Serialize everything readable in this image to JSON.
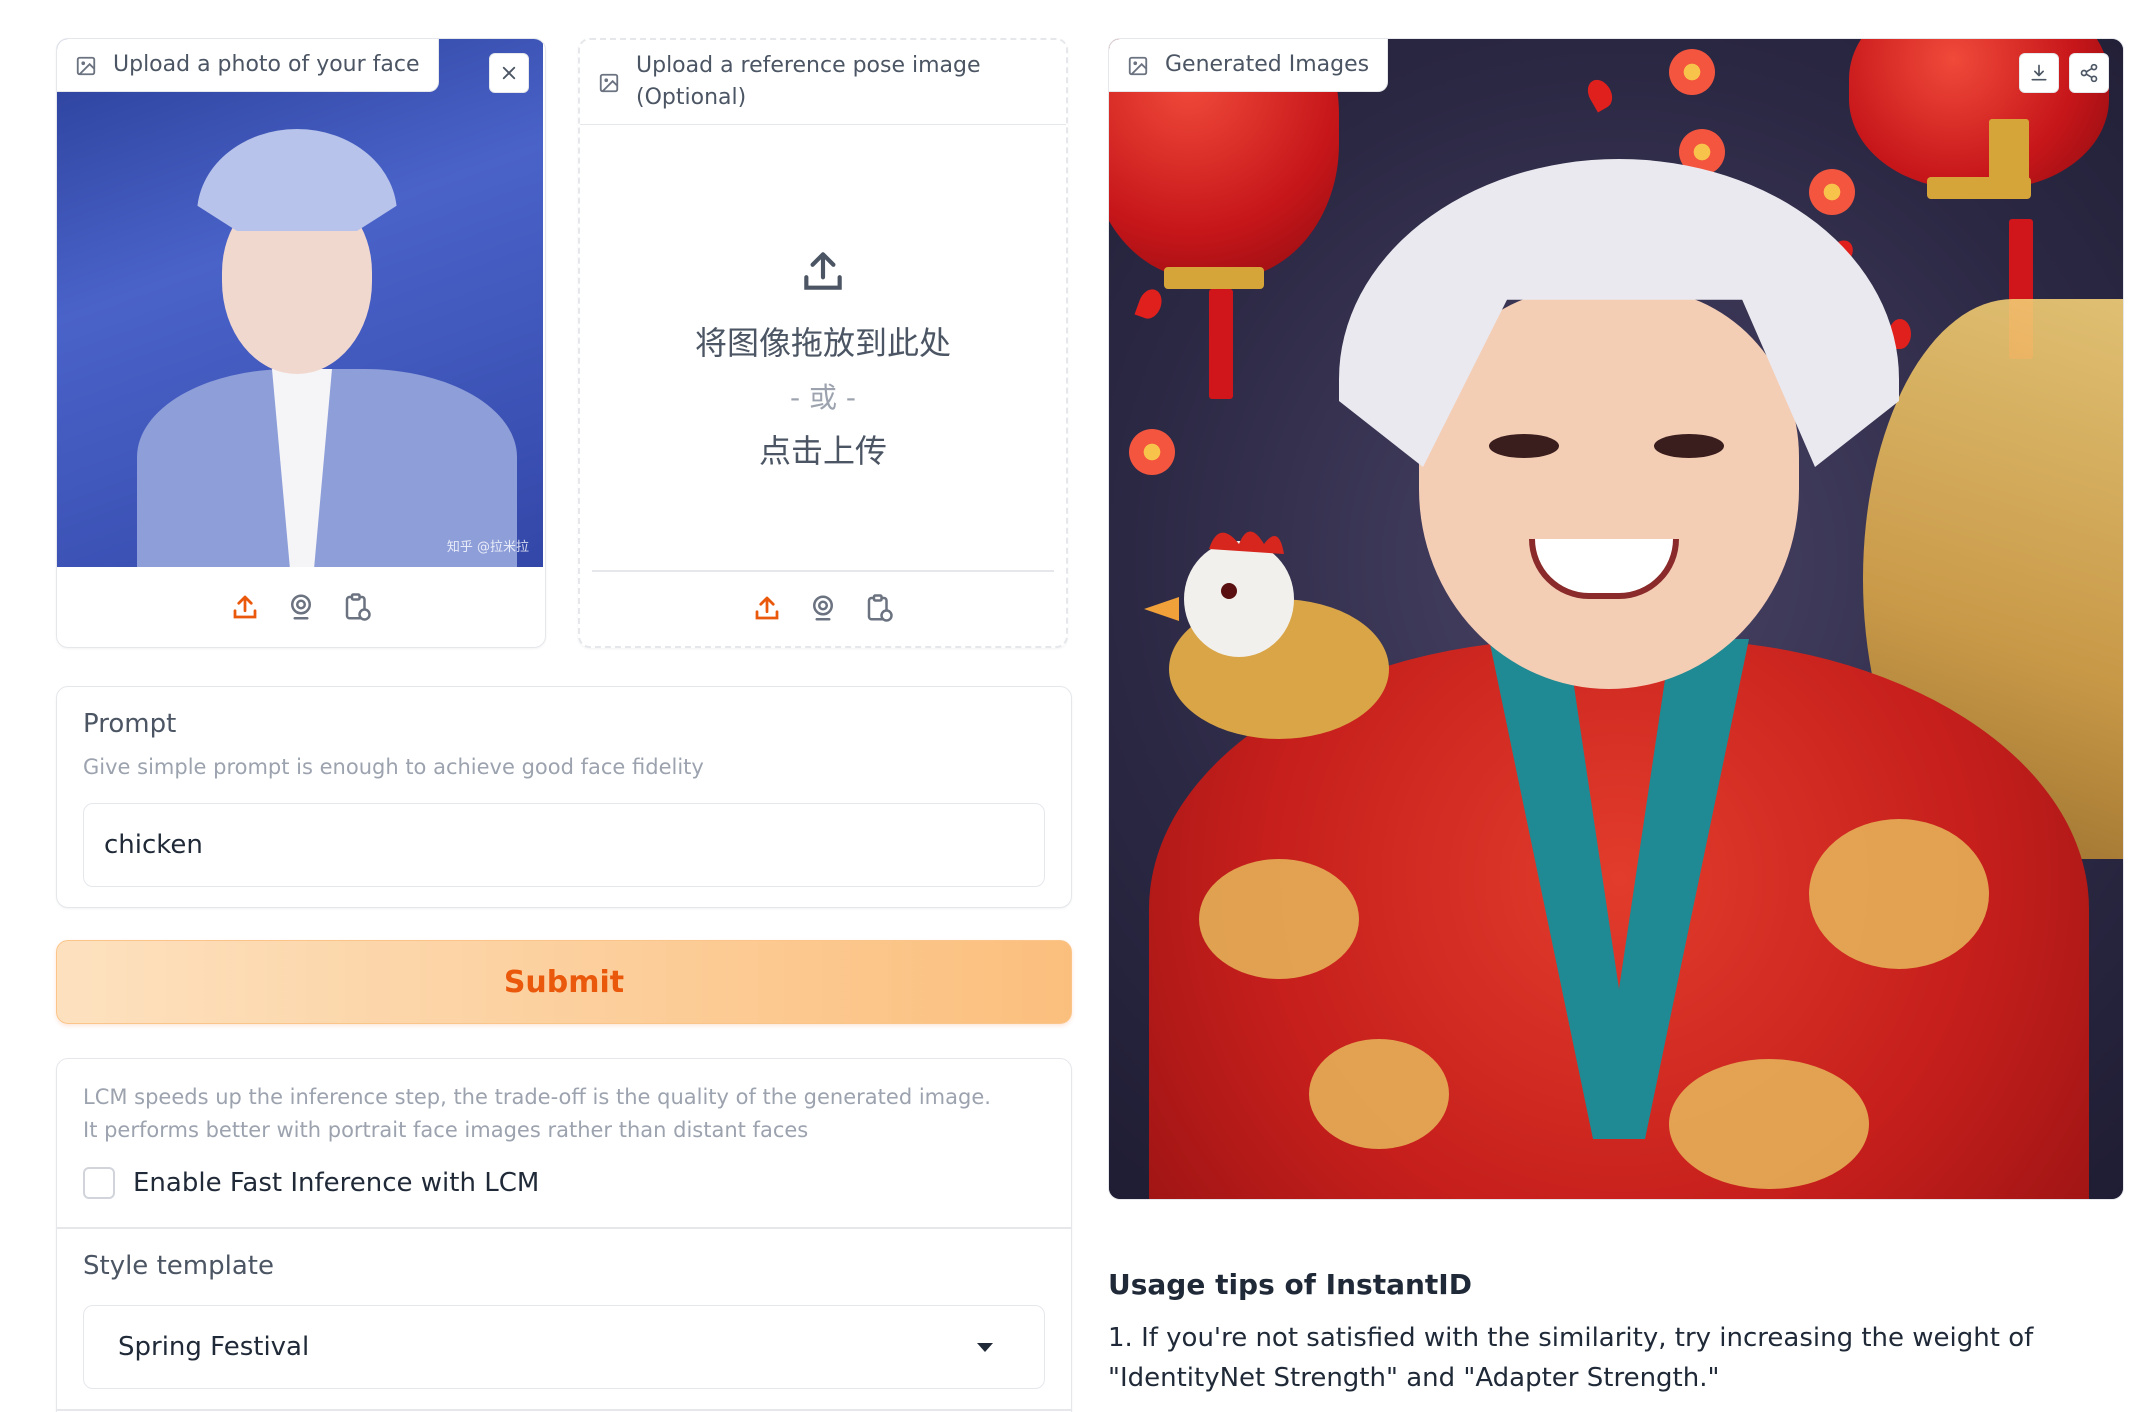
{
  "face_upload": {
    "label": "Upload a photo of your face",
    "watermark": "知乎 @拉米拉"
  },
  "pose_upload": {
    "label": "Upload a reference pose image (Optional)",
    "drop_text": "将图像拖放到此处",
    "or_text": "- 或 -",
    "click_text": "点击上传"
  },
  "prompt": {
    "label": "Prompt",
    "info": "Give simple prompt is enough to achieve good face fidelity",
    "value": "chicken"
  },
  "submit_label": "Submit",
  "lcm": {
    "info": "LCM speeds up the inference step, the trade-off is the quality of the generated image. It performs better with portrait face images rather than distant faces",
    "checkbox_label": "Enable Fast Inference with LCM",
    "checked": false
  },
  "style": {
    "label": "Style template",
    "value": "Spring Festival"
  },
  "generated": {
    "label": "Generated Images"
  },
  "tips": {
    "title": "Usage tips of InstantID",
    "item1": "1. If you're not satisfied with the similarity, try increasing the weight of \"IdentityNet Strength\" and \"Adapter Strength.\""
  },
  "colors": {
    "accent": "#ea580c",
    "submit_start": "#fde1bf",
    "submit_end": "#fbbf7d",
    "border": "#e5e7eb"
  }
}
